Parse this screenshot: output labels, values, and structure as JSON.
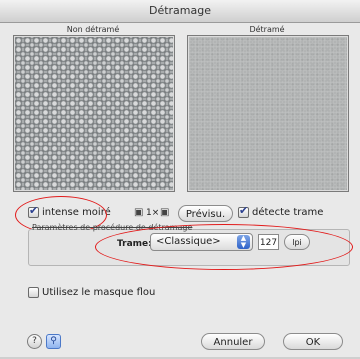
{
  "window": {
    "title": "Détramage"
  },
  "previews": {
    "left_label": "Non détramé",
    "right_label": "Détramé"
  },
  "options": {
    "intense_moire_label": "intense moiré",
    "intense_moire_checked": true,
    "zoom_label": "1×",
    "preview_button": "Prévisu.",
    "detect_label": "détecte trame",
    "detect_checked": true
  },
  "params": {
    "group_label": "Paramètres de procédure de détramage",
    "trame_label": "Trame:",
    "trame_value": "<Classique>",
    "lpi_value": "127",
    "unit_label": "lpi"
  },
  "footer": {
    "masque_label": "Utilisez le masque flou",
    "masque_checked": false,
    "cancel_button": "Annuler",
    "ok_button": "OK"
  },
  "accent_colors": {
    "annotation": "#e21b1b",
    "checkmark": "#2a3f8f",
    "select_arrow": "#2e62c9"
  }
}
